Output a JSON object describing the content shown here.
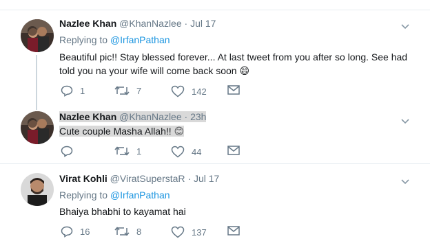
{
  "tweets": [
    {
      "name": "Nazlee Khan",
      "handle": "@KhanNazlee",
      "time": "· Jul 17",
      "replying_prefix": "Replying to",
      "replying_to": "@IrfanPathan",
      "text_line1": "Beautiful pic!! Stay blessed forever... At last tweet from you after so long. See had",
      "text_line2": "told you na your wife will come back soon",
      "emoji": "😄",
      "replies": "1",
      "retweets": "7",
      "likes": "142"
    },
    {
      "name": "Nazlee Khan",
      "handle": "@KhanNazlee",
      "time": "· 23h",
      "text_line1": "Cute couple Masha Allah!!",
      "emoji": "😊",
      "replies": "",
      "retweets": "1",
      "likes": "44"
    },
    {
      "name": "Virat Kohli",
      "handle": "@ViratSuperstaR",
      "time": "· Jul 17",
      "replying_prefix": "Replying to",
      "replying_to": "@IrfanPathan",
      "text_line1": "Bhaiya bhabhi to kayamat hai",
      "replies": "16",
      "retweets": "8",
      "likes": "137"
    }
  ]
}
